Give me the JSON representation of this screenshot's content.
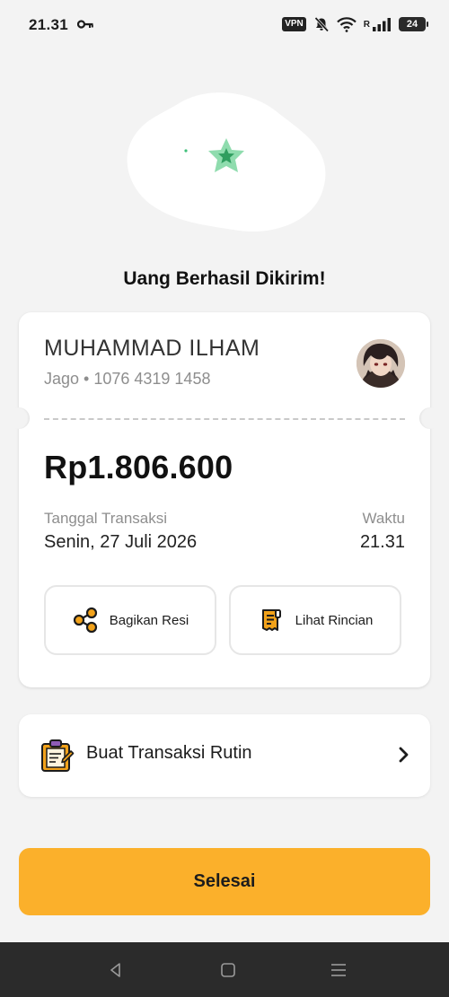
{
  "status_bar": {
    "time": "21.31",
    "vpn": "VPN",
    "signal_letter": "R",
    "battery": "24"
  },
  "success_message": "Uang Berhasil Dikirim!",
  "recipient": {
    "name": "MUHAMMAD ILHAM",
    "account": "Jago • 1076 4319 1458"
  },
  "transaction": {
    "amount": "Rp1.806.600",
    "date_label": "Tanggal Transaksi",
    "date_value": "Senin, 27 Juli 2026",
    "time_label": "Waktu",
    "time_value": "21.31"
  },
  "actions": {
    "share_label": "Bagikan Resi",
    "detail_label": "Lihat Rincian"
  },
  "routine": {
    "label": "Buat Transaksi Rutin"
  },
  "done_button": {
    "label": "Selesai"
  },
  "colors": {
    "accent": "#fbb02b",
    "success_green": "#3fc07a",
    "icon_orange": "#f2a21a",
    "nav_bar": "#2b2b2b"
  }
}
